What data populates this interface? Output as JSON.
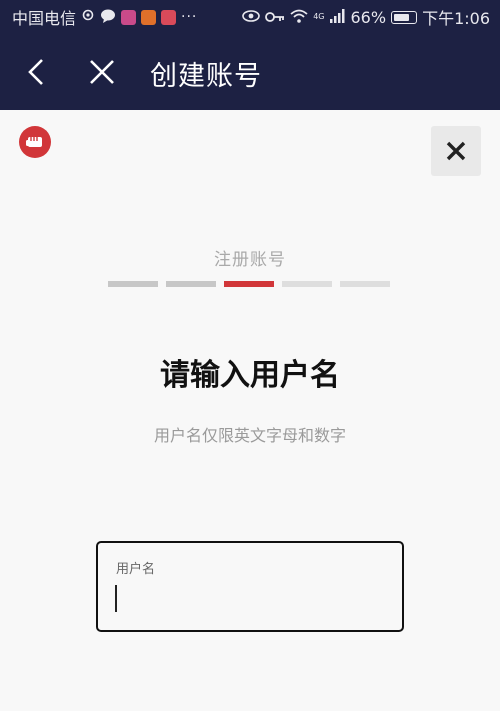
{
  "status_bar": {
    "carrier": "中国电信",
    "notification_icons": [
      "location-icon",
      "chat-icon",
      "app-icon-red",
      "video-icon",
      "calendar-icon"
    ],
    "more": "···",
    "network": "4G",
    "battery": "66%",
    "time": "下午1:06"
  },
  "nav": {
    "title": "创建账号"
  },
  "signup": {
    "step_title": "注册账号",
    "steps": [
      "done",
      "done",
      "active",
      "future",
      "future"
    ],
    "heading": "请输入用户名",
    "subtext": "用户名仅限英文字母和数字",
    "field_label": "用户名",
    "field_value": ""
  },
  "colors": {
    "header_bg": "#1d2143",
    "accent": "#d13639",
    "page_bg": "#f8f8f8"
  }
}
